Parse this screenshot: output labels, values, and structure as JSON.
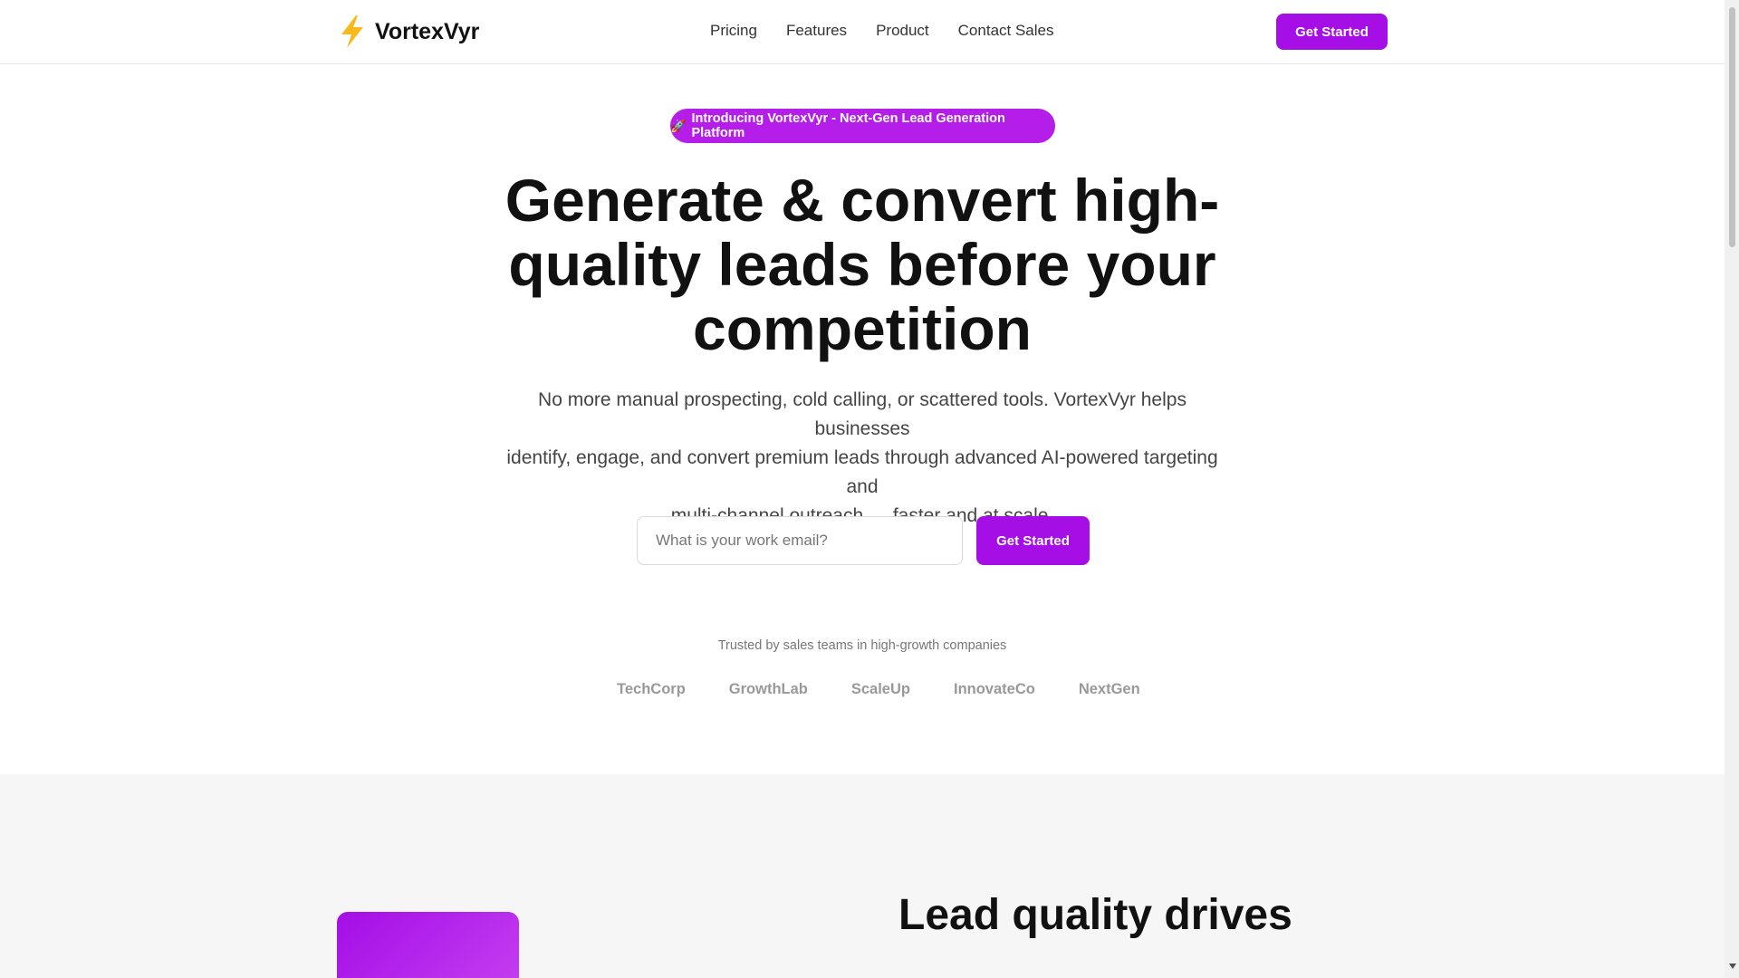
{
  "colors": {
    "accent": "#a50fe6",
    "badge": "#b41ee8",
    "text": "#111111",
    "muted": "#777777",
    "section_bg": "#f6f6f6"
  },
  "header": {
    "brand_icon": "lightning-bolt-icon",
    "brand_name": "VortexVyr",
    "nav": [
      "Pricing",
      "Features",
      "Product",
      "Contact Sales"
    ],
    "cta_label": "Get Started"
  },
  "hero": {
    "badge_icon": "rocket-icon",
    "badge_text": "Introducing VortexVyr - Next-Gen Lead Generation Platform",
    "title_lines": [
      "Generate & convert high-",
      "quality leads before your",
      "competition"
    ],
    "subtitle_lines": [
      "No more manual prospecting, cold calling, or scattered tools. VortexVyr helps businesses",
      "identify, engage, and convert premium leads through advanced AI-powered targeting and",
      "multi-channel outreach — faster and at scale."
    ],
    "email_placeholder": "What is your work email?",
    "cta_label": "Get Started"
  },
  "trusted": {
    "label": "Trusted by sales teams in high-growth companies",
    "logos": [
      "TechCorp",
      "GrowthLab",
      "ScaleUp",
      "InnovateCo",
      "NextGen"
    ]
  },
  "section2": {
    "title": "Lead quality drives"
  }
}
